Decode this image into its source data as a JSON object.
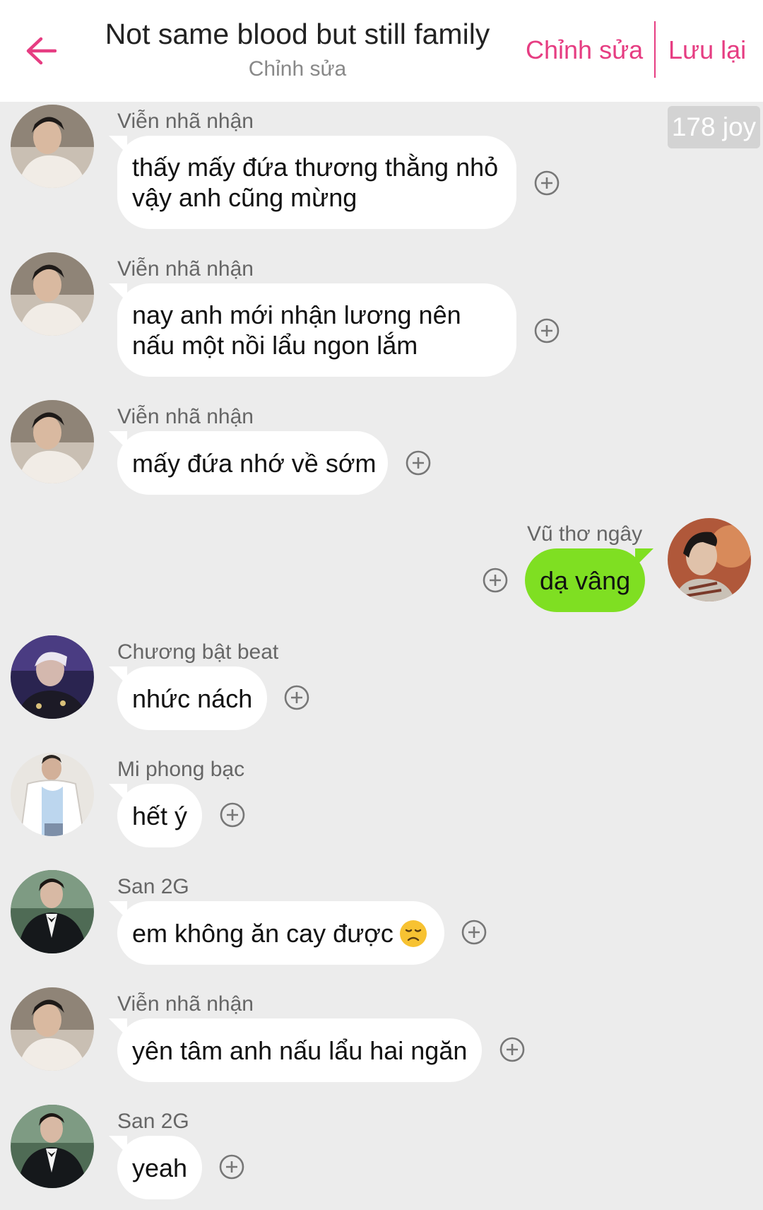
{
  "header": {
    "title": "Not same blood but still family",
    "subtitle": "Chỉnh sửa",
    "edit_label": "Chỉnh sửa",
    "save_label": "Lưu lại",
    "accent_color": "#e63d82"
  },
  "counter": "178 joy",
  "messages": [
    {
      "sender": "Viễn nhã nhận",
      "lines": [
        "thấy mấy đứa thương thằng nhỏ",
        "vậy anh cũng mừng"
      ]
    },
    {
      "sender": "Viễn nhã nhận",
      "lines": [
        "nay anh mới nhận lương nên",
        "nấu một nồi lẩu ngon lắm"
      ]
    },
    {
      "sender": "Viễn nhã nhận",
      "text": "mấy đứa nhớ về sớm"
    },
    {
      "sender": "Vũ thơ ngây",
      "text": "dạ vâng",
      "own": true
    },
    {
      "sender": "Chương bật beat",
      "text": "nhức nách"
    },
    {
      "sender": "Mi phong bạc",
      "text": "hết ý"
    },
    {
      "sender": "San 2G",
      "text": "em không ăn cay được",
      "emoji": "disappointed-face"
    },
    {
      "sender": "Viễn nhã nhận",
      "text": "yên tâm anh nấu lẩu hai ngăn"
    },
    {
      "sender": "San 2G",
      "text": "yeah"
    }
  ],
  "colors": {
    "own_bubble": "#7fdf22",
    "other_bubble": "#ffffff",
    "background": "#ececec"
  }
}
